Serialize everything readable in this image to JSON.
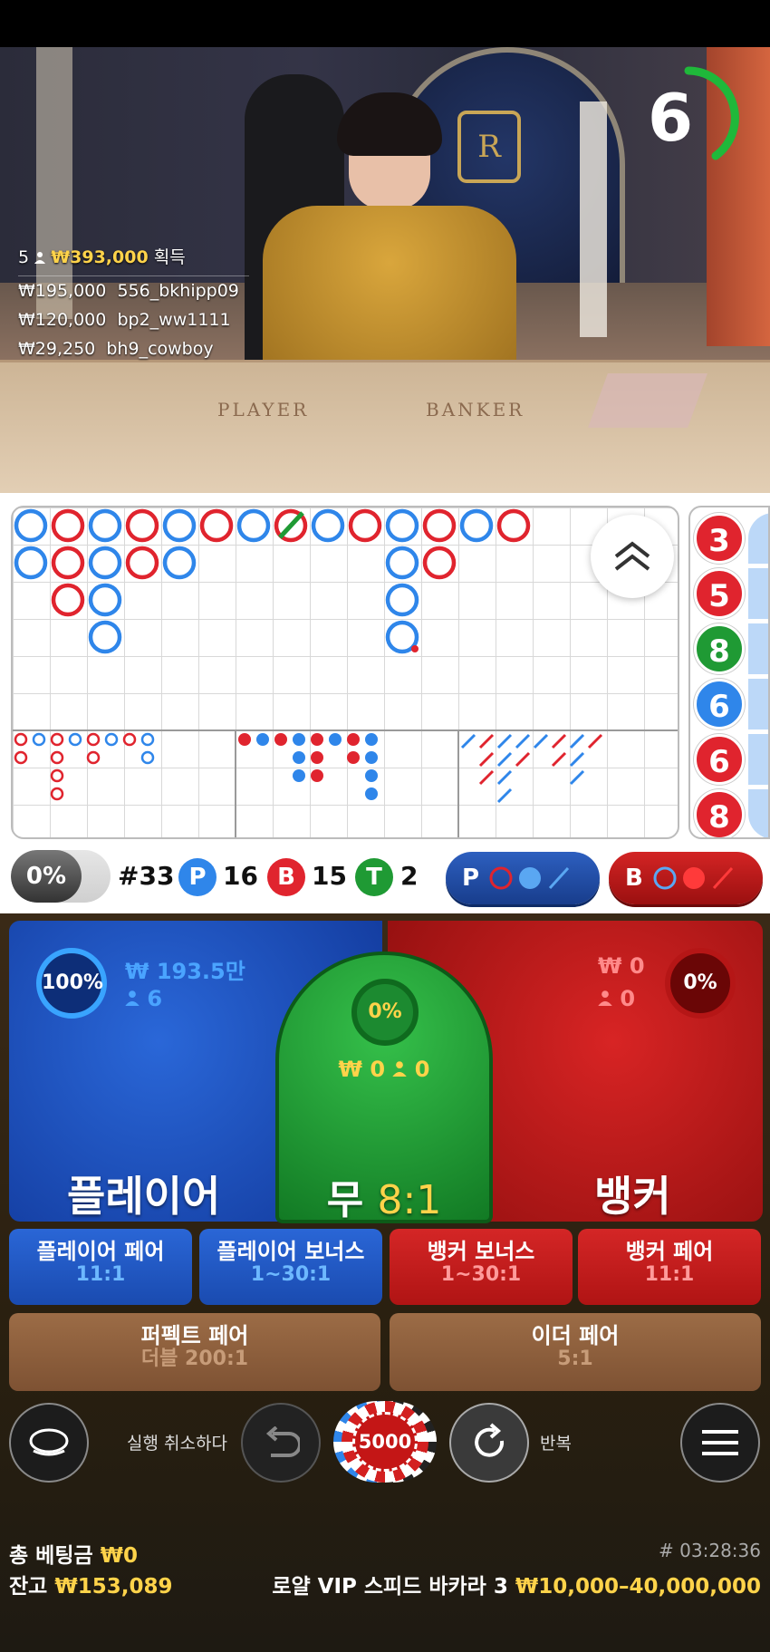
{
  "video": {
    "timer": "6",
    "winners_count": "5",
    "winners_total": "₩393,000",
    "winners_suffix": "획득",
    "winners": [
      {
        "amount": "₩195,000",
        "user": "556_bkhipp09"
      },
      {
        "amount": "₩120,000",
        "user": "bp2_ww1111"
      },
      {
        "amount": "₩29,250",
        "user": "bh9_cowboy"
      }
    ],
    "table_player": "PLAYER",
    "table_banker": "BANKER"
  },
  "side_results": [
    "3",
    "5",
    "8",
    "6",
    "6",
    "8"
  ],
  "stats": {
    "percent": "0%",
    "round": "#33",
    "p_letter": "P",
    "p_count": "16",
    "b_letter": "B",
    "b_count": "15",
    "t_letter": "T",
    "t_count": "2",
    "predict_p": "P",
    "predict_b": "B"
  },
  "bets": {
    "player": {
      "label": "플레이어",
      "pct": "100%",
      "amount": "₩ 193.5만",
      "users": "6"
    },
    "tie": {
      "label": "무",
      "odds": "8:1",
      "pct": "0%",
      "amount": "₩ 0",
      "users": "0"
    },
    "banker": {
      "label": "뱅커",
      "pct": "0%",
      "amount": "₩ 0",
      "users": "0"
    },
    "player_pair": {
      "label": "플레이어 페어",
      "odds": "11:1"
    },
    "player_bonus": {
      "label": "플레이어 보너스",
      "odds": "1~30:1"
    },
    "banker_bonus": {
      "label": "뱅커 보너스",
      "odds": "1~30:1"
    },
    "banker_pair": {
      "label": "뱅커 페어",
      "odds": "11:1"
    },
    "perfect_pair": {
      "label": "퍼펙트 페어",
      "odds": "더블 200:1"
    },
    "either_pair": {
      "label": "이더 페어",
      "odds": "5:1"
    }
  },
  "controls": {
    "undo_label": "실행 취소하다",
    "chip_value": "5000",
    "repeat_label": "반복"
  },
  "footer": {
    "total_bet_label": "총 베팅금",
    "total_bet_value": "₩0",
    "balance_label": "잔고",
    "balance_value": "₩153,089",
    "game_id": "# 03:28:36",
    "table_name": "로얄 VIP 스피드 바카라 3",
    "limits": "₩10,000–40,000,000"
  },
  "colors": {
    "player": "#1d5fd6",
    "banker": "#d61f1f",
    "tie": "#1f9a34",
    "gold": "#ffd34a"
  },
  "icons": [
    "user-icon",
    "chevrons-up-icon",
    "chat-icon",
    "undo-icon",
    "redo-icon",
    "menu-icon"
  ]
}
